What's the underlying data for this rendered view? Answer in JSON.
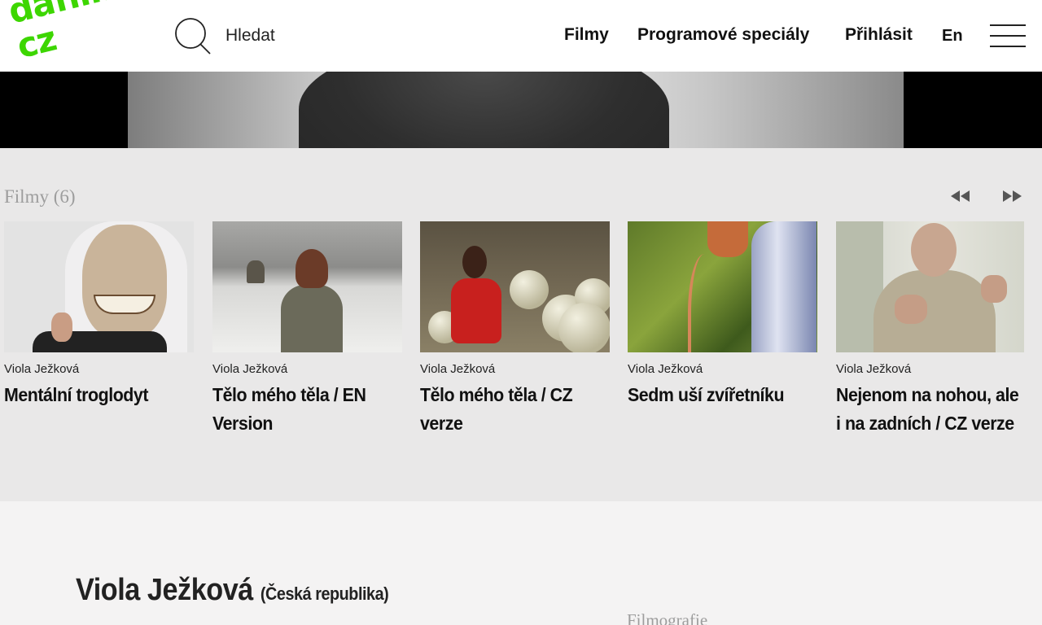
{
  "header": {
    "logo_text": "dafilms.\ncz",
    "search_placeholder": "Hledat",
    "nav": {
      "films": "Filmy",
      "specials": "Programové speciály",
      "login": "Přihlásit",
      "lang": "En"
    }
  },
  "films_section": {
    "title": "Filmy (6)",
    "films": [
      {
        "author": "Viola Ježková",
        "title": "Mentální troglodyt"
      },
      {
        "author": "Viola Ježková",
        "title": "Tělo mého těla / EN Version"
      },
      {
        "author": "Viola Ježková",
        "title": "Tělo mého těla / CZ verze"
      },
      {
        "author": "Viola Ježková",
        "title": "Sedm uší zvířetníku"
      },
      {
        "author": "Viola Ježková",
        "title": "Nejenom na nohou, ale i na zadních / CZ verze"
      }
    ]
  },
  "profile": {
    "name": "Viola Ježková",
    "country": "(Česká republika)",
    "filmography_label": "Filmografie"
  },
  "colors": {
    "logo": "#3dd600",
    "films_bg": "#e9e8e8",
    "page_bg": "#f4f3f3"
  }
}
